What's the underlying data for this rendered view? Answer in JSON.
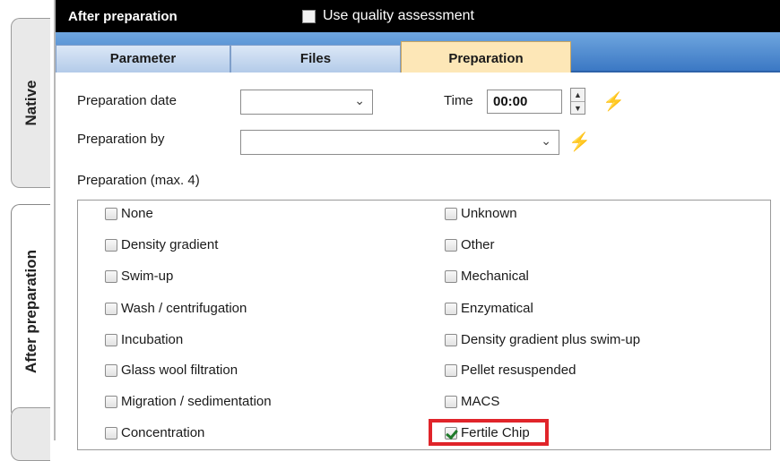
{
  "side_tabs": {
    "native": "Native",
    "after": "After preparation"
  },
  "header": {
    "title": "After preparation",
    "quality_label": "Use quality assessment"
  },
  "tabs": {
    "parameter": "Parameter",
    "files": "Files",
    "preparation": "Preparation"
  },
  "form": {
    "prep_date_label": "Preparation date",
    "prep_date_value": "",
    "time_label": "Time",
    "time_value": "00:00",
    "prep_by_label": "Preparation by",
    "prep_by_value": "",
    "group_label": "Preparation (max. 4)"
  },
  "checkboxes": {
    "left": [
      {
        "label": "None",
        "checked": false
      },
      {
        "label": "Density gradient",
        "checked": false
      },
      {
        "label": "Swim-up",
        "checked": false
      },
      {
        "label": "Wash / centrifugation",
        "checked": false
      },
      {
        "label": "Incubation",
        "checked": false
      },
      {
        "label": "Glass wool filtration",
        "checked": false
      },
      {
        "label": "Migration / sedimentation",
        "checked": false
      },
      {
        "label": "Concentration",
        "checked": false
      }
    ],
    "right": [
      {
        "label": "Unknown",
        "checked": false
      },
      {
        "label": "Other",
        "checked": false
      },
      {
        "label": "Mechanical",
        "checked": false
      },
      {
        "label": "Enzymatical",
        "checked": false
      },
      {
        "label": "Density gradient plus swim-up",
        "checked": false
      },
      {
        "label": "Pellet resuspended",
        "checked": false
      },
      {
        "label": "MACS",
        "checked": false
      },
      {
        "label": "Fertile Chip",
        "checked": true
      }
    ]
  },
  "colors": {
    "highlight": "#e0242a",
    "active_tab": "#fde7b7",
    "tab_bar": "#3b78c4"
  }
}
